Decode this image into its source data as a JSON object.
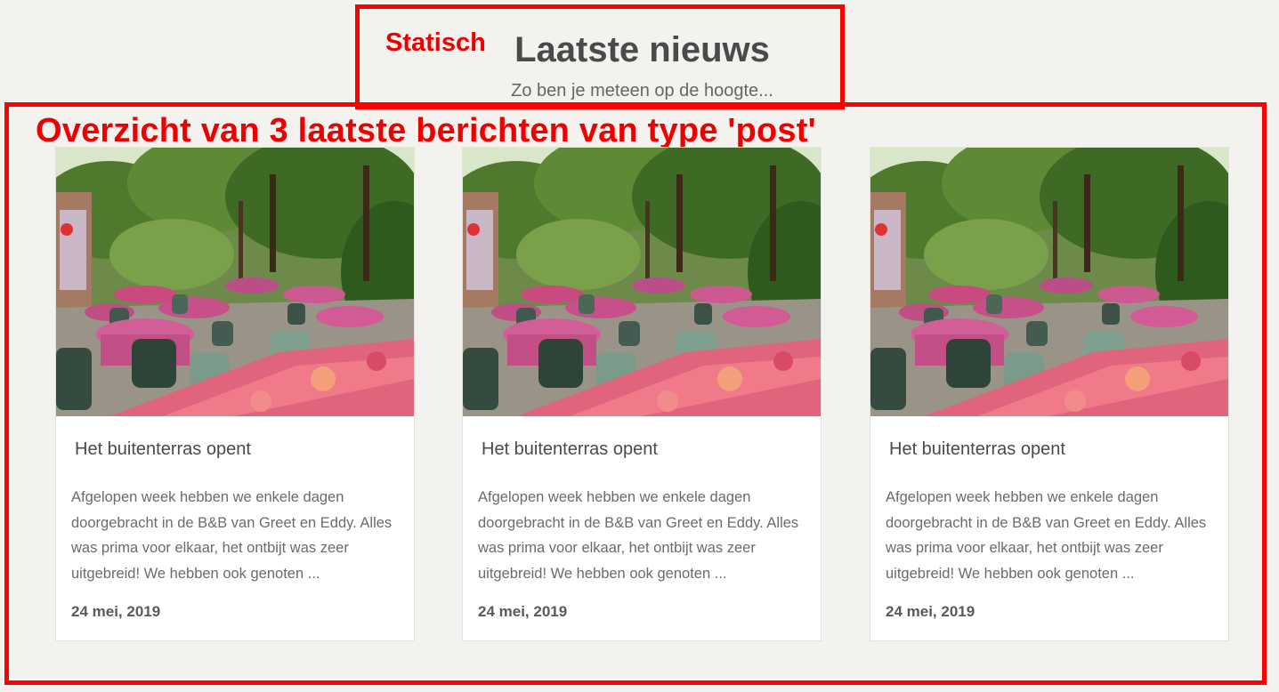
{
  "annotations": {
    "static_label": "Statisch",
    "overview_label": "Overzicht van 3 laatste berichten van type 'post'",
    "color": "#ff0000"
  },
  "section": {
    "title": "Laatste nieuws",
    "subtitle": "Zo ben je meteen op de hoogte..."
  },
  "posts": [
    {
      "image": "outdoor-terrace-photo",
      "title": "Het buitenterras opent",
      "excerpt_lines": [
        "Afgelopen week hebben we enkele dagen",
        "doorgebracht in de B&B van Greet en Eddy. Alles",
        "was prima voor elkaar, het ontbijt was zeer",
        "uitgebreid! We hebben ook genoten ..."
      ],
      "date": "24 mei, 2019"
    },
    {
      "image": "outdoor-terrace-photo",
      "title": "Het buitenterras opent",
      "excerpt_lines": [
        "Afgelopen week hebben we enkele dagen",
        "doorgebracht in de B&B van Greet en Eddy. Alles",
        "was prima voor elkaar, het ontbijt was zeer",
        "uitgebreid! We hebben ook genoten ..."
      ],
      "date": "24 mei, 2019"
    },
    {
      "image": "outdoor-terrace-photo",
      "title": "Het buitenterras opent",
      "excerpt_lines": [
        "Afgelopen week hebben we enkele dagen",
        "doorgebracht in de B&B van Greet en Eddy. Alles",
        "was prima voor elkaar, het ontbijt was zeer",
        "uitgebreid! We hebben ook genoten ..."
      ],
      "date": "24 mei, 2019"
    }
  ]
}
